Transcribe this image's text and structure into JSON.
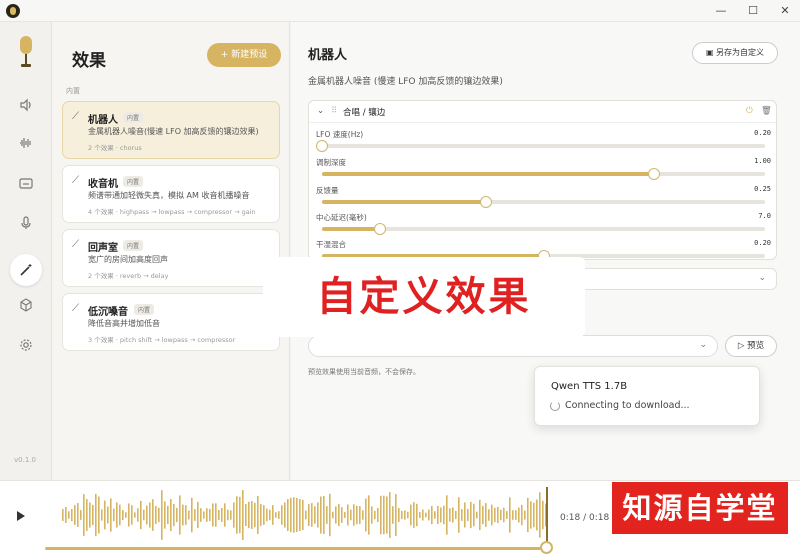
{
  "colors": {
    "accent": "#d6b461",
    "overlay_text": "#e02121",
    "watermark_bg": "#e3231d"
  },
  "window": {
    "min_icon": "—",
    "max_icon": "☐",
    "close_icon": "✕"
  },
  "rail": {
    "version": "v0.1.0",
    "icons": [
      "speaker-icon",
      "waveform-icon",
      "subtitle-icon",
      "microphone-icon",
      "magic-wand-icon",
      "cube-icon",
      "gear-icon"
    ]
  },
  "left": {
    "title": "效果",
    "new_button": "+  新建预设",
    "section": "内置",
    "presets": [
      {
        "name": "机器人",
        "tag": "内置",
        "desc": "金属机器人噪音(慢速 LFO 加高反馈的镶边效果)",
        "meta": "2 个效果 · chorus"
      },
      {
        "name": "收音机",
        "tag": "内置",
        "desc": "频谱带通加轻微失真，模拟 AM 收音机播噪音",
        "meta": "4 个效果 · highpass → lowpass → compressor → gain"
      },
      {
        "name": "回声室",
        "tag": "内置",
        "desc": "宽广的房间加高度回声",
        "meta": "2 个效果 · reverb → delay"
      },
      {
        "name": "低沉嗓音",
        "tag": "内置",
        "desc": "降低音高并增加低音",
        "meta": "3 个效果 · pitch shift → lowpass → compressor"
      }
    ]
  },
  "main": {
    "title": "机器人",
    "save_button": "另存为自定义",
    "subtitle": "金属机器人噪音 (慢速 LFO 加高反馈的镶边效果)",
    "effect_name": "合唱 / 镶边",
    "params": [
      {
        "label": "LFO 速度(Hz)",
        "value": "0.20",
        "level": 0.0
      },
      {
        "label": "调制深度",
        "value": "1.00",
        "level": 0.75
      },
      {
        "label": "反馈量",
        "value": "0.25",
        "level": 0.37
      },
      {
        "label": "中心延迟(毫秒)",
        "value": "7.0",
        "level": 0.13
      },
      {
        "label": "干湿混合",
        "value": "0.20",
        "level": 0.5
      }
    ],
    "preview_button": "预览",
    "hint": "预览效果使用当前音频，不会保存。"
  },
  "toast": {
    "title": "Qwen TTS 1.7B",
    "message": "Connecting to download..."
  },
  "overlay_text": "自定义效果",
  "watermark": "知源自学堂",
  "player": {
    "time": "0:18 / 0:18",
    "progress": 1.0
  }
}
